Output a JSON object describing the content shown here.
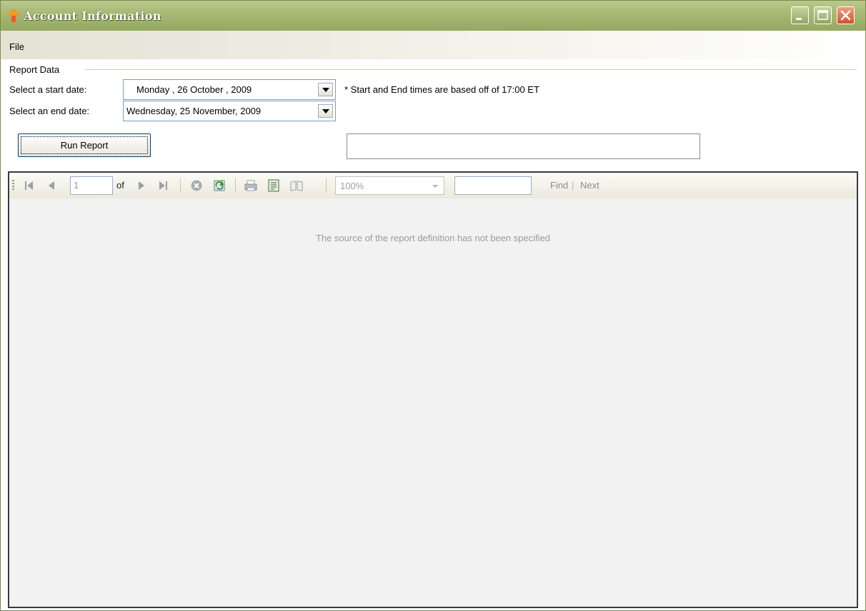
{
  "window": {
    "title": "Account Information"
  },
  "menu": {
    "file_label": "File"
  },
  "report_group": {
    "title": "Report Data",
    "start_label": "Select a start date:",
    "start_value": "Monday    , 26  October  , 2009",
    "end_label": "Select an end date:",
    "end_value": "Wednesday, 25 November, 2009",
    "note": "* Start and End times are based off of 17:00 ET",
    "run_button": "Run Report",
    "status_text": ""
  },
  "viewer": {
    "page_value": "1",
    "of_label": "of",
    "zoom_value": "100%",
    "find_label": "Find",
    "separator": "|",
    "next_label": "Next",
    "message": "The source of the report definition has not been specified"
  }
}
